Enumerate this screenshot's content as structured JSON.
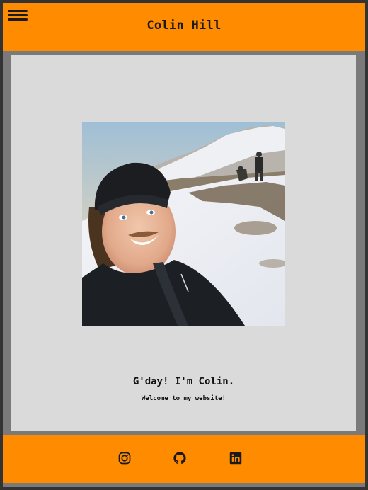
{
  "header": {
    "title": "Colin Hill",
    "menu_icon": "hamburger-menu-icon",
    "background_color": "#ff8c00"
  },
  "main": {
    "greeting": "G'day! I'm Colin.",
    "welcome": "Welcome to my website!",
    "photo_description_icon": "profile-photo",
    "background_color": "#dadada"
  },
  "footer": {
    "social_links": [
      {
        "icon": "instagram-icon"
      },
      {
        "icon": "github-icon"
      },
      {
        "icon": "linkedin-icon"
      }
    ],
    "background_color": "#ff8c00"
  }
}
